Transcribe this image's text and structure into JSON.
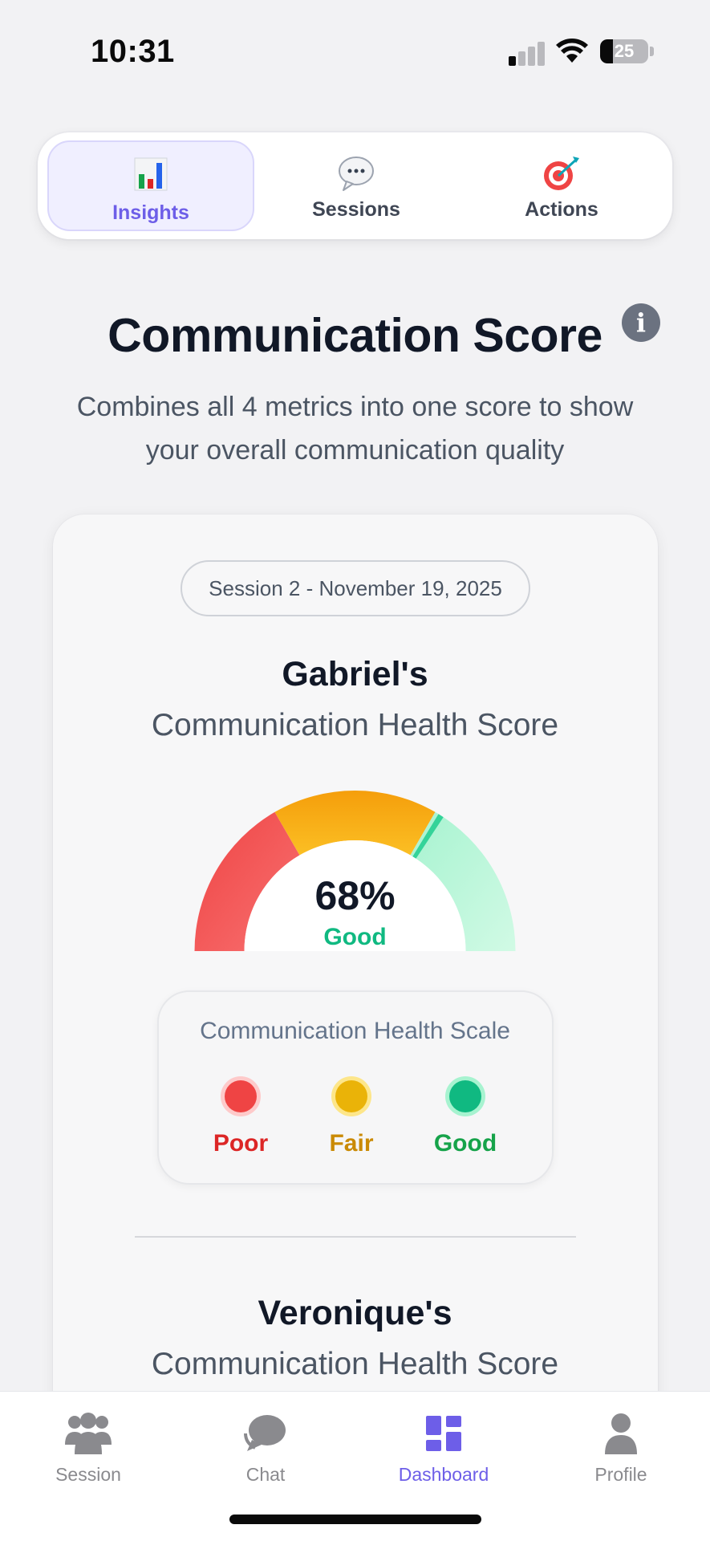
{
  "status_bar": {
    "time": "10:31",
    "battery": "25"
  },
  "top_tabs": [
    {
      "label": "Insights",
      "icon": "bar-chart-icon",
      "active": true
    },
    {
      "label": "Sessions",
      "icon": "speech-bubble-icon",
      "active": false
    },
    {
      "label": "Actions",
      "icon": "target-icon",
      "active": false
    }
  ],
  "header": {
    "title": "Communication Score",
    "info_glyph": "i",
    "subtitle": "Combines all 4 metrics into one score to show your overall communication quality"
  },
  "card": {
    "session_label": "Session 2 - November 19, 2025",
    "person1": {
      "name": "Gabriel's",
      "subtitle": "Communication Health Score",
      "score": "68%",
      "score_value": 68,
      "rating": "Good"
    },
    "scale": {
      "title": "Communication Health Scale",
      "items": [
        {
          "label": "Poor",
          "color": "#ef4444",
          "text_color": "#dc2626"
        },
        {
          "label": "Fair",
          "color": "#eab308",
          "text_color": "#ca8a04"
        },
        {
          "label": "Good",
          "color": "#10b981",
          "text_color": "#16a34a"
        }
      ]
    },
    "person2": {
      "name": "Veronique's",
      "subtitle": "Communication Health Score"
    }
  },
  "bottom_nav": [
    {
      "label": "Session",
      "icon": "people-icon",
      "active": false
    },
    {
      "label": "Chat",
      "icon": "chat-bubble-icon",
      "active": false
    },
    {
      "label": "Dashboard",
      "icon": "dashboard-icon",
      "active": true
    },
    {
      "label": "Profile",
      "icon": "person-icon",
      "active": false
    }
  ],
  "colors": {
    "accent": "#6d5ee8",
    "good": "#10b981",
    "poor": "#ef4444",
    "fair": "#f59e0b"
  }
}
